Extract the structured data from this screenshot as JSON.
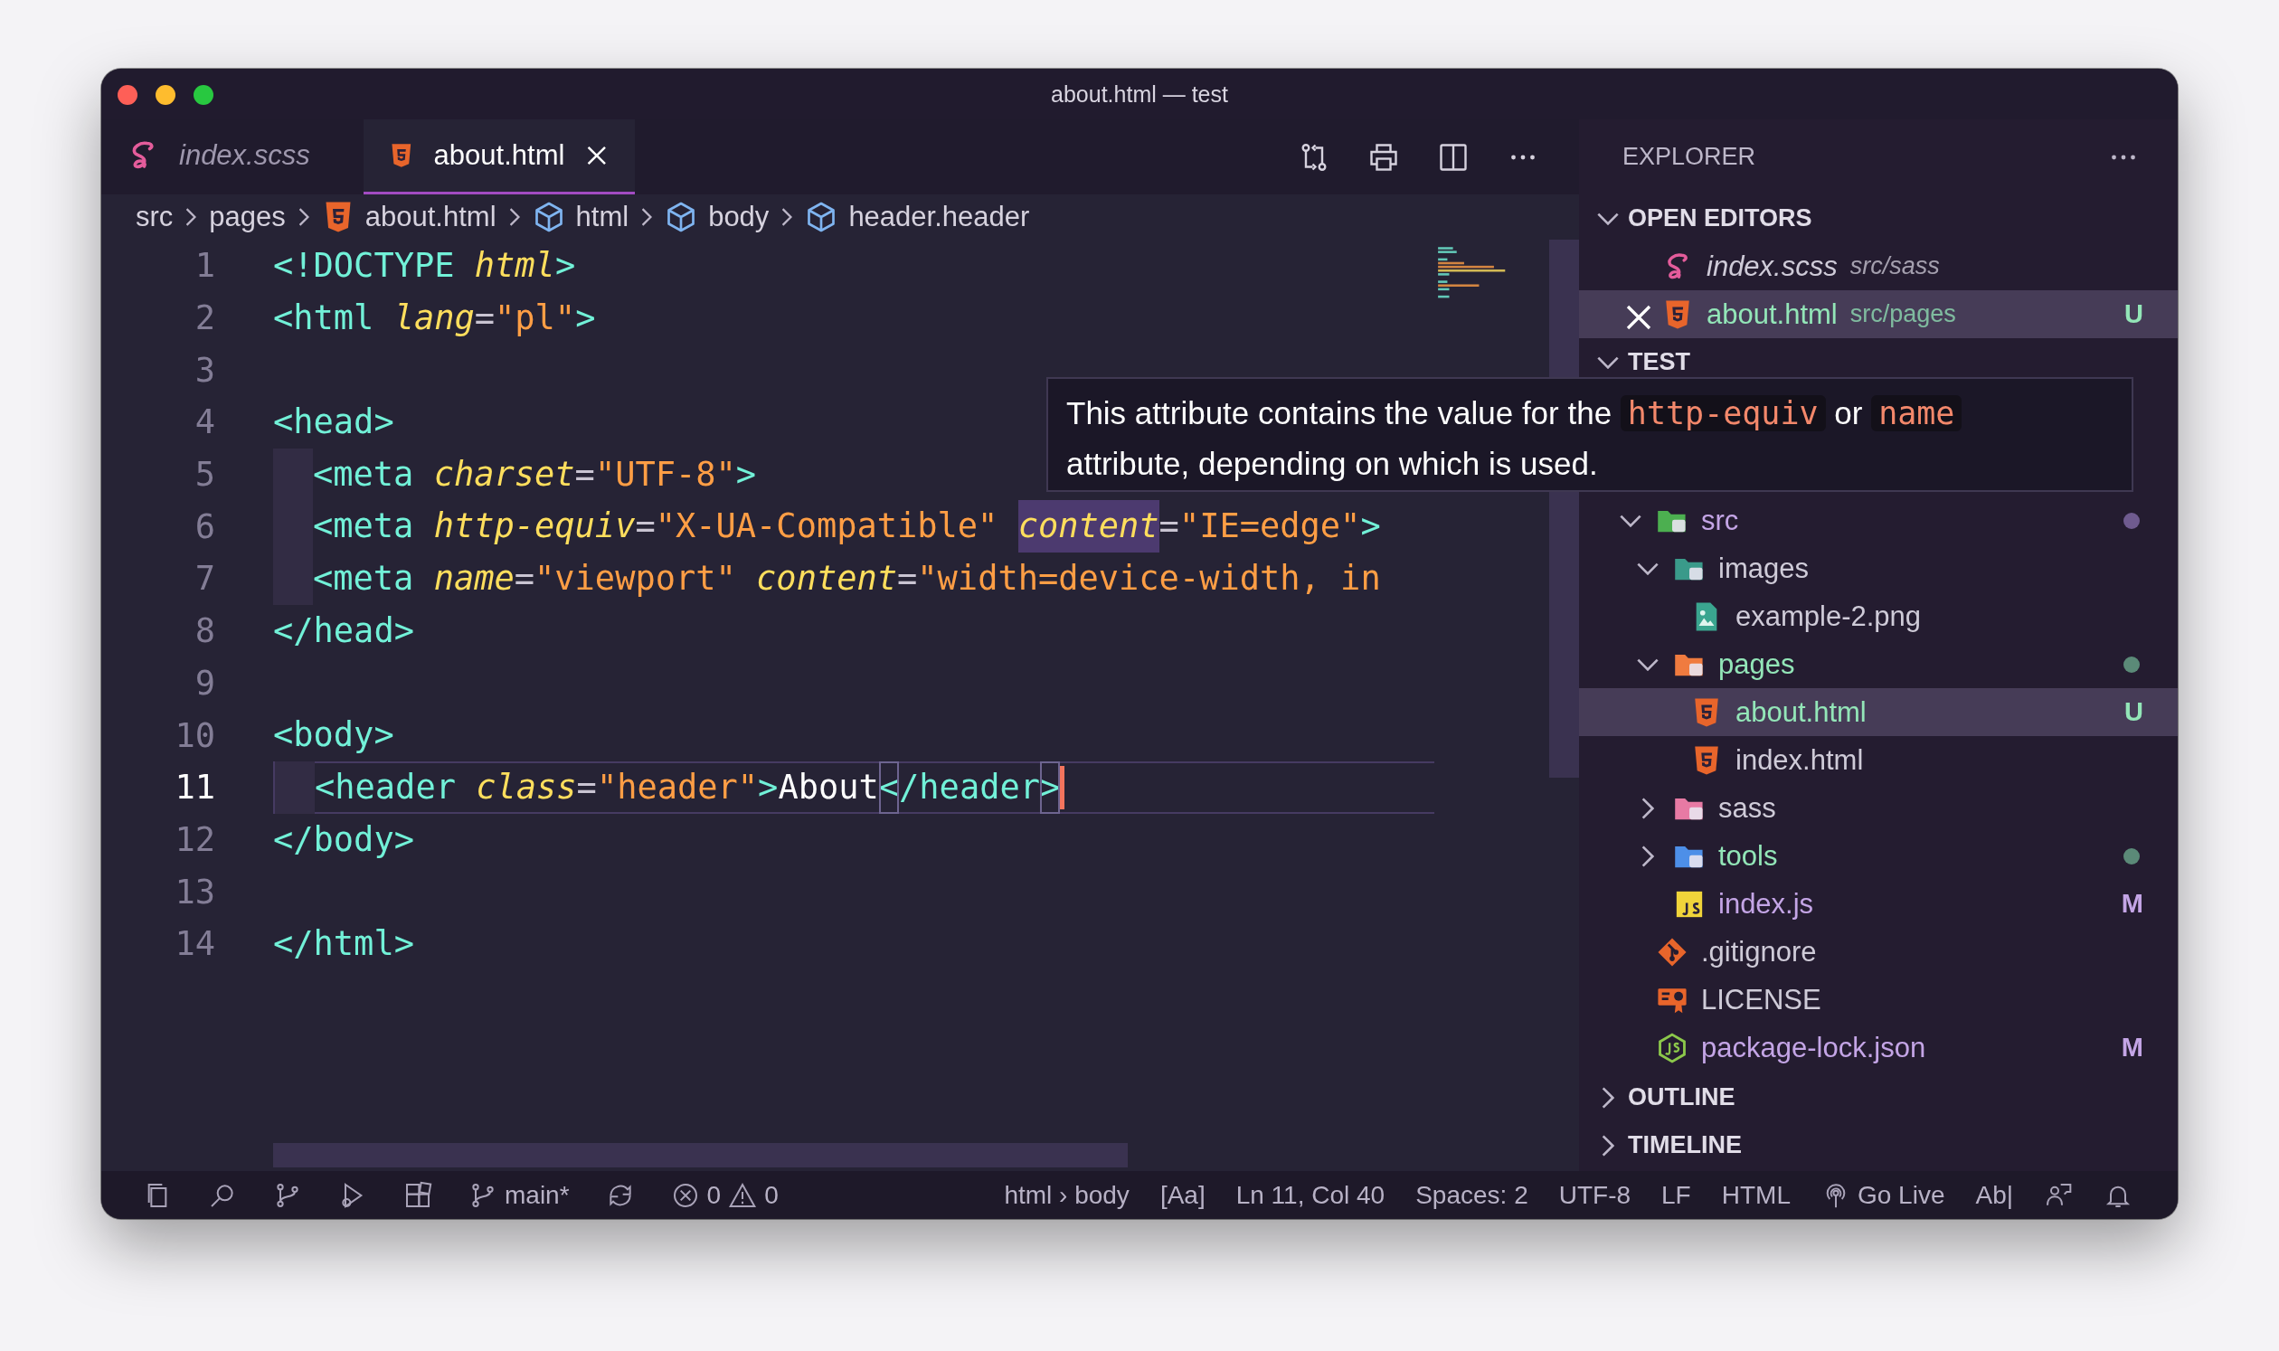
{
  "window": {
    "title": "about.html — test"
  },
  "tabs": [
    {
      "label": "index.scss",
      "kind": "sass",
      "preview": true,
      "selected": false
    },
    {
      "label": "about.html",
      "kind": "html",
      "preview": false,
      "selected": true
    }
  ],
  "breadcrumb": [
    {
      "label": "src",
      "kind": "folder"
    },
    {
      "label": "pages",
      "kind": "folder"
    },
    {
      "label": "about.html",
      "kind": "html"
    },
    {
      "label": "html",
      "kind": "element"
    },
    {
      "label": "body",
      "kind": "element"
    },
    {
      "label": "header.header",
      "kind": "element"
    }
  ],
  "code": {
    "lines": [
      {
        "number": "1",
        "current": false,
        "indent": false,
        "tokens": [
          {
            "t": "<!DOCTYPE ",
            "kind": "tag",
            "highlighted": false
          },
          {
            "t": "html",
            "kind": "attr",
            "highlighted": false
          },
          {
            "t": ">",
            "kind": "tag",
            "highlighted": false
          }
        ]
      },
      {
        "number": "2",
        "current": false,
        "indent": false,
        "tokens": [
          {
            "t": "<html ",
            "kind": "tag",
            "highlighted": false
          },
          {
            "t": "lang",
            "kind": "attr",
            "highlighted": false
          },
          {
            "t": "=",
            "kind": "eq",
            "highlighted": false
          },
          {
            "t": "\"pl\"",
            "kind": "str",
            "highlighted": false
          },
          {
            "t": ">",
            "kind": "tag",
            "highlighted": false
          }
        ]
      },
      {
        "number": "3",
        "current": false,
        "indent": false
      },
      {
        "number": "4",
        "current": false,
        "indent": false,
        "tokens": [
          {
            "t": "<head>",
            "kind": "tag",
            "highlighted": false
          }
        ]
      },
      {
        "number": "5",
        "current": false,
        "indent": true,
        "tokens": [
          {
            "t": "<meta ",
            "kind": "tag",
            "highlighted": false
          },
          {
            "t": "charset",
            "kind": "attr",
            "highlighted": false
          },
          {
            "t": "=",
            "kind": "eq",
            "highlighted": false
          },
          {
            "t": "\"UTF-8\"",
            "kind": "str",
            "highlighted": false
          },
          {
            "t": ">",
            "kind": "tag",
            "highlighted": false
          }
        ]
      },
      {
        "number": "6",
        "current": false,
        "indent": true,
        "tokens": [
          {
            "t": "<meta ",
            "kind": "tag",
            "highlighted": false
          },
          {
            "t": "http-equiv",
            "kind": "attr",
            "highlighted": false
          },
          {
            "t": "=",
            "kind": "eq",
            "highlighted": false
          },
          {
            "t": "\"X-UA-Compatible\" ",
            "kind": "str",
            "highlighted": false
          },
          {
            "t": "content",
            "kind": "attr",
            "highlighted": true
          },
          {
            "t": "=",
            "kind": "eq",
            "highlighted": false
          },
          {
            "t": "\"IE=edge\"",
            "kind": "str",
            "highlighted": false
          },
          {
            "t": ">",
            "kind": "tag",
            "highlighted": false
          }
        ]
      },
      {
        "number": "7",
        "current": false,
        "indent": true,
        "tokens": [
          {
            "t": "<meta ",
            "kind": "tag",
            "highlighted": false
          },
          {
            "t": "name",
            "kind": "attr",
            "highlighted": false
          },
          {
            "t": "=",
            "kind": "eq",
            "highlighted": false
          },
          {
            "t": "\"viewport\" ",
            "kind": "str",
            "highlighted": false
          },
          {
            "t": "content",
            "kind": "attr",
            "highlighted": false
          },
          {
            "t": "=",
            "kind": "eq",
            "highlighted": false
          },
          {
            "t": "\"width=device-width, in",
            "kind": "str",
            "highlighted": false
          }
        ]
      },
      {
        "number": "8",
        "current": false,
        "indent": false,
        "tokens": [
          {
            "t": "</head>",
            "kind": "tag",
            "highlighted": false
          }
        ]
      },
      {
        "number": "9",
        "current": false,
        "indent": false
      },
      {
        "number": "10",
        "current": false,
        "indent": false,
        "tokens": [
          {
            "t": "<body>",
            "kind": "tag",
            "highlighted": false
          }
        ]
      },
      {
        "number": "11",
        "current": true,
        "indent": true,
        "tokens": [
          {
            "t": "<header ",
            "kind": "tag",
            "highlighted": false
          },
          {
            "t": "class",
            "kind": "attr",
            "highlighted": false
          },
          {
            "t": "=",
            "kind": "eq",
            "highlighted": false
          },
          {
            "t": "\"header\"",
            "kind": "str",
            "highlighted": false
          },
          {
            "t": ">",
            "kind": "tag",
            "highlighted": false
          },
          {
            "t": "About",
            "kind": "text",
            "highlighted": false
          },
          {
            "t": "<",
            "kind": "tag",
            "highlighted": true
          },
          {
            "t": "/header",
            "kind": "tag",
            "highlighted": false
          },
          {
            "t": ">",
            "kind": "tag",
            "highlighted": true
          }
        ]
      },
      {
        "number": "12",
        "current": false,
        "indent": false,
        "tokens": [
          {
            "t": "</body>",
            "kind": "tag",
            "highlighted": false
          }
        ]
      },
      {
        "number": "13",
        "current": false,
        "indent": false
      },
      {
        "number": "14",
        "current": false,
        "indent": false,
        "tokens": [
          {
            "t": "</html>",
            "kind": "tag",
            "highlighted": false
          }
        ]
      }
    ]
  },
  "tooltip": {
    "segments": [
      {
        "t": "This attribute contains the value for the ",
        "code": false
      },
      {
        "t": "http-equiv",
        "code": true
      },
      {
        "t": " or ",
        "code": false
      },
      {
        "t": "name",
        "code": true
      },
      {
        "t": " attribute, depending on which is used.",
        "code": false
      }
    ]
  },
  "sidebar": {
    "title": "EXPLORER",
    "open_editors": {
      "title": "OPEN EDITORS",
      "expanded": true,
      "items": [
        {
          "name": "index.scss",
          "path": "src/sass",
          "kind": "sass",
          "preview": true,
          "selected": false,
          "untracked": false,
          "modified": false
        },
        {
          "name": "about.html",
          "path": "src/pages",
          "kind": "html",
          "preview": false,
          "selected": true,
          "untracked": true,
          "modified": false,
          "badge": "U"
        }
      ]
    },
    "tree": {
      "title": "TEST",
      "expanded": true,
      "items": [
        {
          "name": "src",
          "kind": "source_folder",
          "expanded": true,
          "selected": false,
          "untracked": false,
          "modified": true,
          "color": "#6f5b8f",
          "children": [
            {
              "name": "images",
              "kind": "image_folder",
              "expanded": true,
              "selected": false,
              "untracked": false,
              "modified": false,
              "children": [
                {
                  "name": "example-2.png",
                  "kind": "image",
                  "selected": false,
                  "untracked": false,
                  "modified": false
                }
              ]
            },
            {
              "name": "pages",
              "kind": "page_folder",
              "expanded": true,
              "selected": false,
              "untracked": true,
              "modified": false,
              "color": "#5b8a78",
              "children": [
                {
                  "name": "about.html",
                  "kind": "html",
                  "selected": true,
                  "untracked": true,
                  "modified": false,
                  "badge": "U"
                },
                {
                  "name": "index.html",
                  "kind": "html",
                  "selected": false,
                  "untracked": false,
                  "modified": false
                }
              ]
            },
            {
              "name": "sass",
              "kind": "style_folder",
              "expanded": false,
              "selected": false,
              "untracked": false,
              "modified": false
            },
            {
              "name": "tools",
              "kind": "tool_folder",
              "expanded": false,
              "selected": false,
              "untracked": true,
              "modified": false,
              "color": "#5b8a78"
            },
            {
              "name": "index.js",
              "kind": "script",
              "selected": false,
              "untracked": false,
              "modified": true,
              "badge": "M"
            }
          ]
        },
        {
          "name": ".gitignore",
          "kind": "git",
          "selected": false,
          "untracked": false,
          "modified": false
        },
        {
          "name": "LICENSE",
          "kind": "license",
          "selected": false,
          "untracked": false,
          "modified": false
        },
        {
          "name": "package-lock.json",
          "kind": "node",
          "selected": false,
          "untracked": false,
          "modified": true,
          "badge": "M"
        }
      ]
    },
    "sections": [
      {
        "title": "OUTLINE",
        "expanded": false
      },
      {
        "title": "TIMELINE",
        "expanded": false
      }
    ]
  },
  "status_bar": {
    "branch": "main*",
    "errors": "0",
    "warnings": "0",
    "items": [
      "html › body",
      "[Aa]",
      "Ln 11, Col 40",
      "Spaces: 2",
      "UTF-8",
      "LF",
      "HTML"
    ],
    "live": "Go Live",
    "spell": "Ab|"
  }
}
